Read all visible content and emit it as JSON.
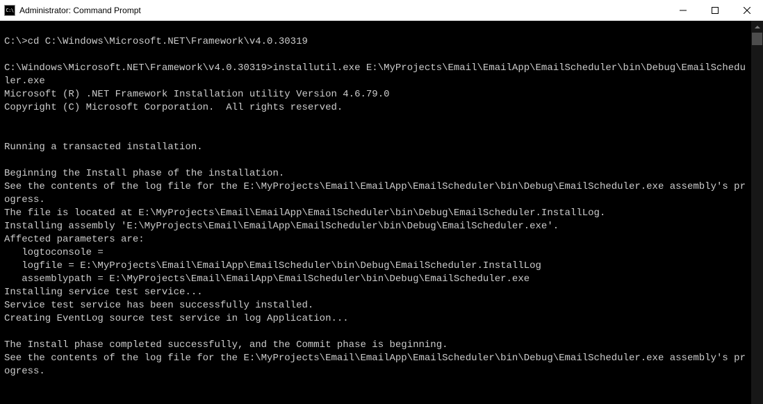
{
  "window": {
    "title": "Administrator: Command Prompt",
    "icon_label": "C:\\"
  },
  "console": {
    "lines": [
      "",
      "C:\\>cd C:\\Windows\\Microsoft.NET\\Framework\\v4.0.30319",
      "",
      "C:\\Windows\\Microsoft.NET\\Framework\\v4.0.30319>installutil.exe E:\\MyProjects\\Email\\EmailApp\\EmailScheduler\\bin\\Debug\\EmailScheduler.exe",
      "Microsoft (R) .NET Framework Installation utility Version 4.6.79.0",
      "Copyright (C) Microsoft Corporation.  All rights reserved.",
      "",
      "",
      "Running a transacted installation.",
      "",
      "Beginning the Install phase of the installation.",
      "See the contents of the log file for the E:\\MyProjects\\Email\\EmailApp\\EmailScheduler\\bin\\Debug\\EmailScheduler.exe assembly's progress.",
      "The file is located at E:\\MyProjects\\Email\\EmailApp\\EmailScheduler\\bin\\Debug\\EmailScheduler.InstallLog.",
      "Installing assembly 'E:\\MyProjects\\Email\\EmailApp\\EmailScheduler\\bin\\Debug\\EmailScheduler.exe'.",
      "Affected parameters are:",
      "   logtoconsole = ",
      "   logfile = E:\\MyProjects\\Email\\EmailApp\\EmailScheduler\\bin\\Debug\\EmailScheduler.InstallLog",
      "   assemblypath = E:\\MyProjects\\Email\\EmailApp\\EmailScheduler\\bin\\Debug\\EmailScheduler.exe",
      "Installing service test service...",
      "Service test service has been successfully installed.",
      "Creating EventLog source test service in log Application...",
      "",
      "The Install phase completed successfully, and the Commit phase is beginning.",
      "See the contents of the log file for the E:\\MyProjects\\Email\\EmailApp\\EmailScheduler\\bin\\Debug\\EmailScheduler.exe assembly's progress."
    ]
  }
}
